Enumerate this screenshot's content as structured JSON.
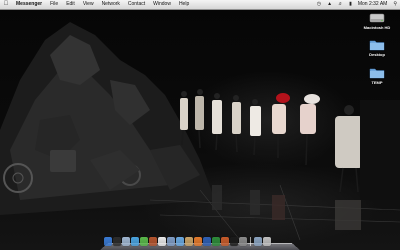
{
  "menubar": {
    "app_name": "Messenger",
    "items": [
      "File",
      "Edit",
      "View",
      "Network",
      "Contact",
      "Window",
      "Help"
    ],
    "clock": "Mon 2:32 AM"
  },
  "desktop": {
    "icons": [
      {
        "label": "Macintosh HD",
        "icon": "hard-drive-icon"
      },
      {
        "label": "Desktop",
        "icon": "folder-icon"
      },
      {
        "label": "TEMP",
        "icon": "folder-icon"
      }
    ]
  },
  "dock": {
    "apps": [
      {
        "name": "finder-icon",
        "color": "#3a7bd5"
      },
      {
        "name": "dashboard-icon",
        "color": "#2c2c2c"
      },
      {
        "name": "mail-icon",
        "color": "#9fb6d1"
      },
      {
        "name": "safari-icon",
        "color": "#4aa3df"
      },
      {
        "name": "ichat-icon",
        "color": "#59b84a"
      },
      {
        "name": "address-book-icon",
        "color": "#b3542e"
      },
      {
        "name": "ical-icon",
        "color": "#e8e8e8"
      },
      {
        "name": "preview-icon",
        "color": "#7f9cc4"
      },
      {
        "name": "itunes-icon",
        "color": "#6aa8e0"
      },
      {
        "name": "photo-icon",
        "color": "#c9a46a"
      },
      {
        "name": "messenger-icon",
        "color": "#e37a2d"
      },
      {
        "name": "word-icon",
        "color": "#2f5fb3"
      },
      {
        "name": "excel-icon",
        "color": "#2e8b3a"
      },
      {
        "name": "powerpoint-icon",
        "color": "#c75b2b"
      },
      {
        "name": "terminal-icon",
        "color": "#1b1b1b"
      },
      {
        "name": "system-preferences-icon",
        "color": "#8a8a8a"
      }
    ],
    "trailing": [
      {
        "name": "documents-stack-icon",
        "color": "#8aa3c0"
      },
      {
        "name": "trash-icon",
        "color": "#c0c0c0"
      }
    ]
  }
}
